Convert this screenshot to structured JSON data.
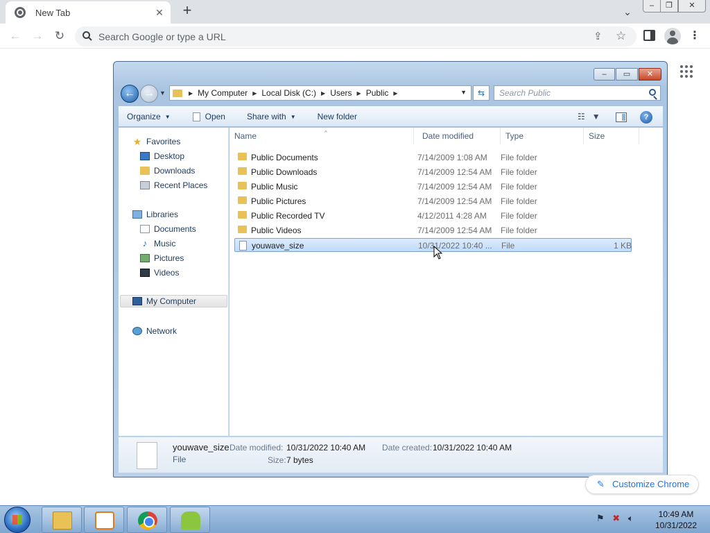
{
  "chrome": {
    "tab_title": "New Tab",
    "tab_close": "✕",
    "new_tab": "+",
    "tab_search": "⌄",
    "omnibox_placeholder": "Search Google or type a URL",
    "customize_label": "Customize Chrome",
    "menu_glyph": "⋮"
  },
  "explorer": {
    "address": [
      "My Computer",
      "Local Disk (C:)",
      "Users",
      "Public"
    ],
    "search_placeholder": "Search Public",
    "commands": {
      "organize": "Organize",
      "open": "Open",
      "share": "Share with",
      "new_folder": "New folder"
    },
    "nav": {
      "favorites": "Favorites",
      "desktop": "Desktop",
      "downloads": "Downloads",
      "recent": "Recent Places",
      "libraries": "Libraries",
      "documents": "Documents",
      "music": "Music",
      "pictures": "Pictures",
      "videos": "Videos",
      "computer": "My Computer",
      "network": "Network"
    },
    "columns": {
      "name": "Name",
      "date": "Date modified",
      "type": "Type",
      "size": "Size"
    },
    "files": [
      {
        "name": "Public Documents",
        "date": "7/14/2009 1:08 AM",
        "type": "File folder",
        "size": ""
      },
      {
        "name": "Public Downloads",
        "date": "7/14/2009 12:54 AM",
        "type": "File folder",
        "size": ""
      },
      {
        "name": "Public Music",
        "date": "7/14/2009 12:54 AM",
        "type": "File folder",
        "size": ""
      },
      {
        "name": "Public Pictures",
        "date": "7/14/2009 12:54 AM",
        "type": "File folder",
        "size": ""
      },
      {
        "name": "Public Recorded TV",
        "date": "4/12/2011 4:28 AM",
        "type": "File folder",
        "size": ""
      },
      {
        "name": "Public Videos",
        "date": "7/14/2009 12:54 AM",
        "type": "File folder",
        "size": ""
      },
      {
        "name": "youwave_size",
        "date": "10/31/2022 10:40 ...",
        "type": "File",
        "size": "1 KB"
      }
    ],
    "details": {
      "name": "youwave_size",
      "type": "File",
      "modified_label": "Date modified:",
      "modified_value": "10/31/2022 10:40 AM",
      "created_label": "Date created:",
      "created_value": "10/31/2022 10:40 AM",
      "size_label": "Size:",
      "size_value": "7 bytes"
    }
  },
  "taskbar": {
    "time": "10:49 AM",
    "date": "10/31/2022"
  }
}
